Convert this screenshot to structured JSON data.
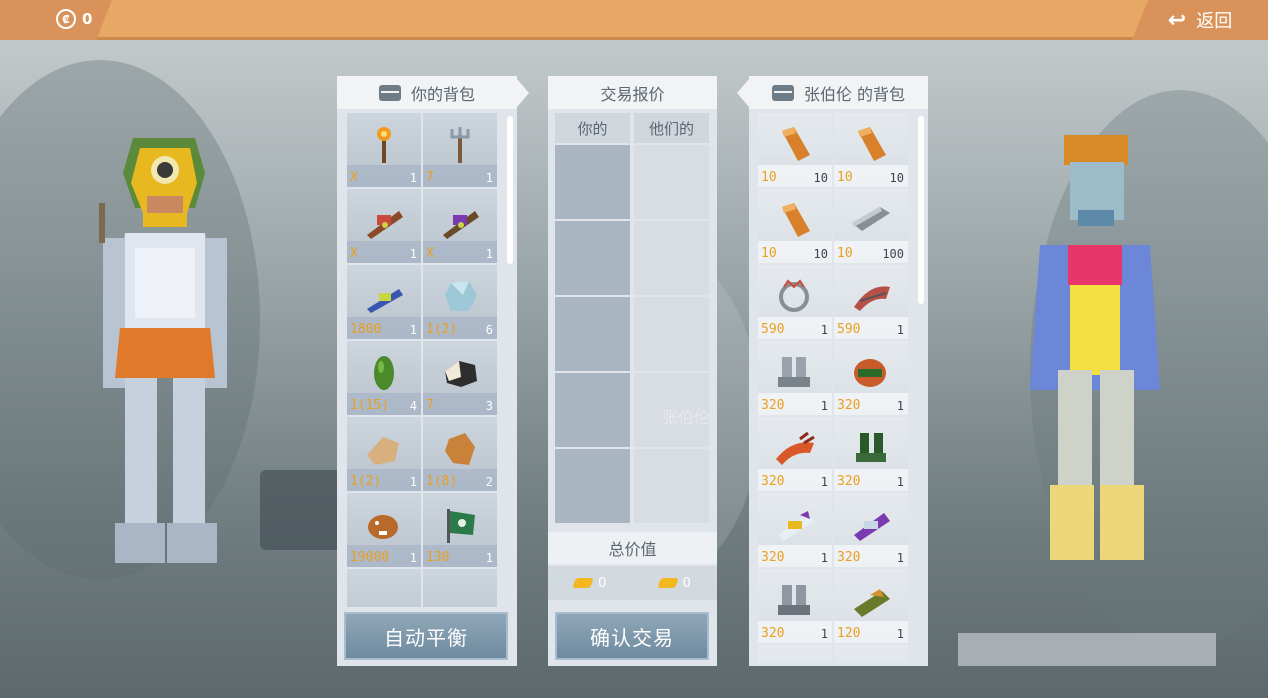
{
  "topbar": {
    "currency_icon": "coin-icon",
    "currency_value": "0",
    "back_label": "返回"
  },
  "left_panel": {
    "title": "你的背包",
    "button": "自动平衡",
    "items": [
      {
        "icon": "torch",
        "val": "X",
        "qty": "1"
      },
      {
        "icon": "trident",
        "val": "7",
        "qty": "1"
      },
      {
        "icon": "crossbow-red",
        "val": "X",
        "qty": "1"
      },
      {
        "icon": "crossbow-purple",
        "val": "X",
        "qty": "1"
      },
      {
        "icon": "blaster",
        "val": "1800",
        "qty": "1"
      },
      {
        "icon": "crystal",
        "val": "1(2)",
        "qty": "6"
      },
      {
        "icon": "cucumber",
        "val": "1(15)",
        "qty": "4"
      },
      {
        "icon": "rock",
        "val": "7",
        "qty": "3"
      },
      {
        "icon": "bread",
        "val": "1(2)",
        "qty": "1"
      },
      {
        "icon": "potato",
        "val": "1(8)",
        "qty": "2"
      },
      {
        "icon": "beaver",
        "val": "19000",
        "qty": "1"
      },
      {
        "icon": "green-flag",
        "val": "130",
        "qty": "1"
      },
      {
        "icon": "empty",
        "val": "",
        "qty": ""
      },
      {
        "icon": "stick",
        "val": "",
        "qty": ""
      }
    ]
  },
  "trade": {
    "title": "交易报价",
    "col_mine": "你的",
    "col_theirs": "他们的",
    "total_label": "总价值",
    "mine_total": "0",
    "theirs_total": "0",
    "button": "确认交易",
    "center_name": "张伯伦"
  },
  "right_panel": {
    "title": "张伯伦 的背包",
    "items": [
      {
        "icon": "copper-bar",
        "val": "10",
        "qty": "10"
      },
      {
        "icon": "copper-bar",
        "val": "10",
        "qty": "10"
      },
      {
        "icon": "copper-bar",
        "val": "10",
        "qty": "10"
      },
      {
        "icon": "iron-bar",
        "val": "10",
        "qty": "100"
      },
      {
        "icon": "helmet-crown",
        "val": "590",
        "qty": "1"
      },
      {
        "icon": "gloves-claw",
        "val": "590",
        "qty": "1"
      },
      {
        "icon": "boots-steel",
        "val": "320",
        "qty": "1"
      },
      {
        "icon": "helmet-red",
        "val": "320",
        "qty": "1"
      },
      {
        "icon": "claw-red",
        "val": "320",
        "qty": "1"
      },
      {
        "icon": "boots-green",
        "val": "320",
        "qty": "1"
      },
      {
        "icon": "gauntlet-white",
        "val": "320",
        "qty": "1"
      },
      {
        "icon": "gauntlet-purple",
        "val": "320",
        "qty": "1"
      },
      {
        "icon": "boots-gray",
        "val": "320",
        "qty": "1"
      },
      {
        "icon": "bracer-green",
        "val": "120",
        "qty": "1"
      },
      {
        "icon": "partial",
        "val": "",
        "qty": ""
      },
      {
        "icon": "partial",
        "val": "",
        "qty": ""
      }
    ]
  }
}
